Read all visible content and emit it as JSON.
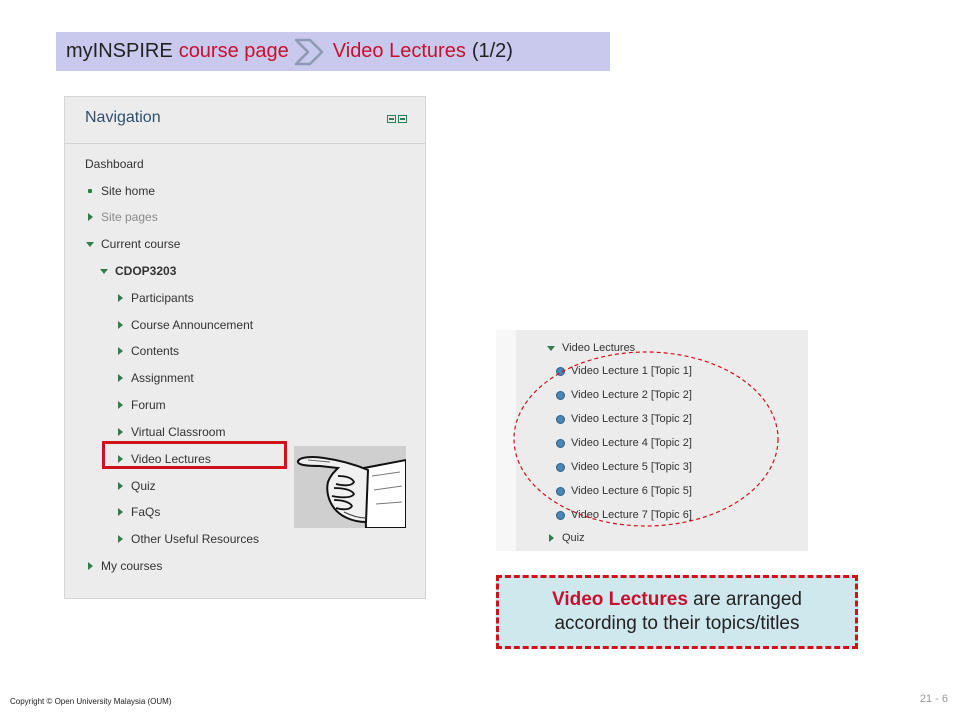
{
  "title": {
    "part1": "myINSPIRE",
    "part2": "course page",
    "part3": "Video Lectures",
    "part4": "(1/2)"
  },
  "navigation": {
    "title": "Navigation",
    "items": [
      {
        "label": "Dashboard",
        "marker": "none"
      },
      {
        "label": "Site home",
        "marker": "dot"
      },
      {
        "label": "Site pages",
        "marker": "right"
      },
      {
        "label": "Current course",
        "marker": "down"
      },
      {
        "label": "CDOP3203",
        "marker": "down"
      },
      {
        "label": "Participants",
        "marker": "right"
      },
      {
        "label": "Course Announcement",
        "marker": "right"
      },
      {
        "label": "Contents",
        "marker": "right"
      },
      {
        "label": "Assignment",
        "marker": "right"
      },
      {
        "label": "Forum",
        "marker": "right"
      },
      {
        "label": "Virtual Classroom",
        "marker": "right"
      },
      {
        "label": "Video Lectures",
        "marker": "right"
      },
      {
        "label": "Quiz",
        "marker": "right"
      },
      {
        "label": "FaQs",
        "marker": "right"
      },
      {
        "label": "Other Useful Resources",
        "marker": "right"
      },
      {
        "label": "My courses",
        "marker": "right"
      }
    ]
  },
  "video_panel": {
    "header": "Video Lectures",
    "lectures": [
      "Video Lecture 1 [Topic 1]",
      "Video Lecture 2 [Topic 2]",
      "Video Lecture 3 [Topic 2]",
      "Video Lecture 4 [Topic 2]",
      "Video Lecture 5 [Topic 3]",
      "Video Lecture 6 [Topic 5]",
      "Video Lecture 7 [Topic 6]"
    ],
    "footer": "Quiz"
  },
  "callout": {
    "highlight": "Video Lectures",
    "rest_line1": "are arranged",
    "line2": "according to their topics/titles"
  },
  "footer": {
    "copyright": "Copyright © Open University Malaysia (OUM)",
    "page": "21 - 6"
  },
  "colors": {
    "accent_red": "#c8102e",
    "title_bar_bg": "#c9c9ee",
    "callout_bg": "#cfe8ee",
    "tree_marker": "#2e7d4a"
  }
}
